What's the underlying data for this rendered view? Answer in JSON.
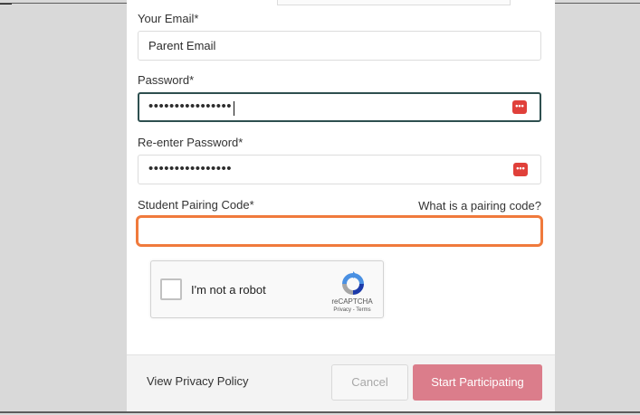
{
  "form": {
    "email": {
      "label": "Your Email*",
      "value": "Parent Email"
    },
    "password": {
      "label": "Password*",
      "value": "••••••••••••••••",
      "icon": "password-manager-icon"
    },
    "reenter_password": {
      "label": "Re-enter Password*",
      "value": "••••••••••••••••",
      "icon": "password-manager-icon"
    },
    "pairing_code": {
      "label": "Student Pairing Code*",
      "help_link": "What is a pairing code?",
      "value": ""
    }
  },
  "recaptcha": {
    "label": "I'm not a robot",
    "brand": "reCAPTCHA",
    "terms": "Privacy - Terms",
    "icon": "recaptcha-logo-icon"
  },
  "footer": {
    "privacy_link": "View Privacy Policy",
    "cancel_label": "Cancel",
    "start_label": "Start Participating"
  },
  "colors": {
    "accent_pink": "#db7d8b",
    "focus_orange": "#f07a3c",
    "focus_dark": "#2e4f4f",
    "icon_red": "#e0403a"
  }
}
